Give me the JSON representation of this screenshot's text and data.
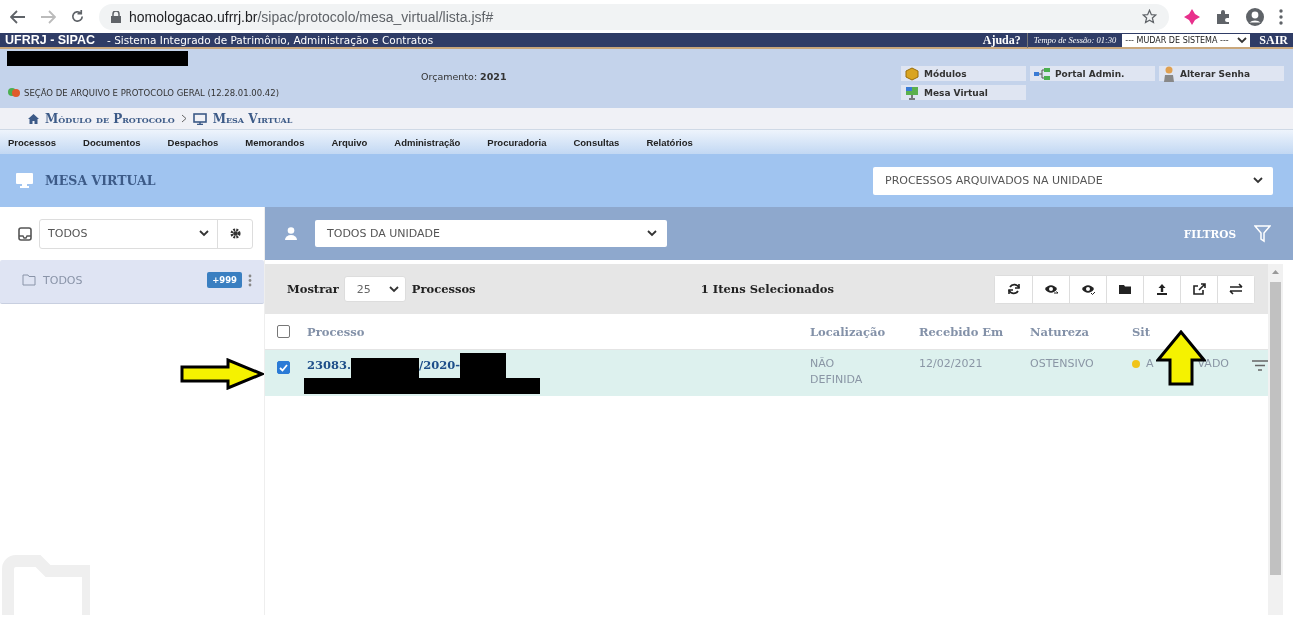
{
  "browser": {
    "url_host": "homologacao.ufrrj.br",
    "url_path": "/sipac/protocolo/mesa_virtual/lista.jsf#"
  },
  "header": {
    "system": "UFRRJ - SIPAC",
    "subtitle": "- Sistema Integrado de Patrimônio, Administração e Contratos",
    "help": "Ajuda?",
    "session_label": "Tempo de Sessão:",
    "session_time": "01:30",
    "system_select": "--- MUDAR DE SISTEMA ---",
    "logout": "SAIR"
  },
  "info": {
    "unit": "SEÇÃO DE ARQUIVO E PROTOCOLO GERAL (12.28.01.00.42)",
    "budget_label": "Orçamento:",
    "budget_year": "2021",
    "links": [
      {
        "label": "Módulos",
        "kind": "box"
      },
      {
        "label": "Portal Admin.",
        "kind": "tree"
      },
      {
        "label": "Alterar Senha",
        "kind": "person"
      },
      {
        "label": "Mesa Virtual",
        "kind": "monitor"
      }
    ]
  },
  "breadcrumb": [
    "Módulo de Protocolo",
    "Mesa Virtual"
  ],
  "menu": [
    "Processos",
    "Documentos",
    "Despachos",
    "Memorandos",
    "Arquivo",
    "Administração",
    "Procuradoria",
    "Consultas",
    "Relatórios"
  ],
  "page_title": "MESA VIRTUAL",
  "view_select": "PROCESSOS ARQUIVADOS NA UNIDADE",
  "sidebar": {
    "box_select": "TODOS",
    "folders": [
      {
        "label": "TODOS",
        "count": "+999",
        "selected": true
      }
    ]
  },
  "filter": {
    "owner_select": "TODOS DA UNIDADE",
    "filters": "FILTROS"
  },
  "list": {
    "show_label": "Mostrar",
    "page_size": "25",
    "unit": "Processos",
    "selection": "1 Itens Selecionados",
    "all_checked": false,
    "columns": [
      "Processo",
      "Localização",
      "Recebido Em",
      "Natureza",
      "Sit"
    ],
    "rows": [
      {
        "checked": true,
        "process": "23083.",
        "process_mid": "/2020-",
        "location": "NÃO DEFINIDA",
        "received": "12/02/2021",
        "nature": "OSTENSIVO",
        "status_parts": [
          "A",
          "VADO"
        ]
      }
    ]
  }
}
